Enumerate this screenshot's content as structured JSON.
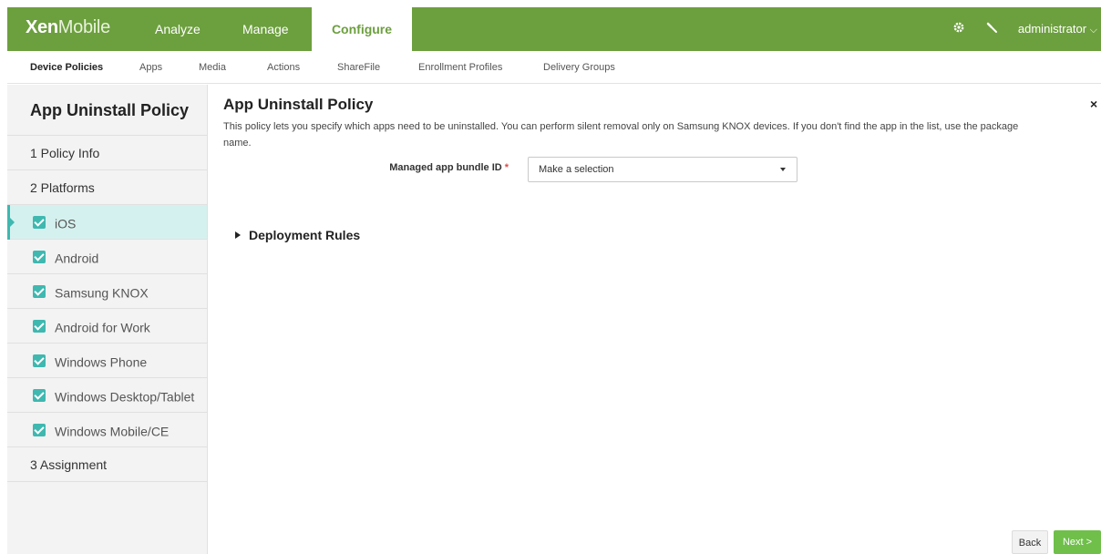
{
  "app": {
    "logo_bold": "Xen",
    "logo_light": "Mobile"
  },
  "top_nav": [
    {
      "label": "Analyze"
    },
    {
      "label": "Manage"
    },
    {
      "label": "Configure",
      "active": true
    }
  ],
  "top_right": {
    "settings_icon": "gear-icon",
    "tools_icon": "wrench-icon",
    "user_label": "administrator",
    "user_caret": "⌵"
  },
  "sub_nav": [
    {
      "label": "Device Policies",
      "active": true
    },
    {
      "label": "Apps"
    },
    {
      "label": "Media"
    },
    {
      "label": "Actions"
    },
    {
      "label": "ShareFile"
    },
    {
      "label": "Enrollment Profiles"
    },
    {
      "label": "Delivery Groups"
    }
  ],
  "sidebar": {
    "title": "App Uninstall Policy",
    "step1": "1  Policy Info",
    "step2": "2  Platforms",
    "platforms": [
      {
        "label": "iOS",
        "checked": true,
        "active": true
      },
      {
        "label": "Android",
        "checked": true
      },
      {
        "label": "Samsung KNOX",
        "checked": true
      },
      {
        "label": "Android for Work",
        "checked": true
      },
      {
        "label": "Windows Phone",
        "checked": true
      },
      {
        "label": "Windows Desktop/Tablet",
        "checked": true
      },
      {
        "label": "Windows Mobile/CE",
        "checked": true
      }
    ],
    "step3": "3  Assignment"
  },
  "main": {
    "title": "App Uninstall Policy",
    "close_glyph": "×",
    "description": "This policy lets you specify which apps need to be uninstalled. You can perform silent removal only on Samsung KNOX devices. If you don't find the app in the list, use the package name.",
    "field_label": "Managed app bundle ID",
    "required_mark": "*",
    "select_value": "Make a selection",
    "deployment_rules": "Deployment Rules"
  },
  "footer": {
    "back_label": "Back",
    "next_label": "Next >"
  },
  "colors": {
    "brand_green": "#6c9f3e",
    "accent_teal": "#3fb8b0",
    "next_green": "#6fbf4a",
    "required_red": "#e04a4a"
  }
}
